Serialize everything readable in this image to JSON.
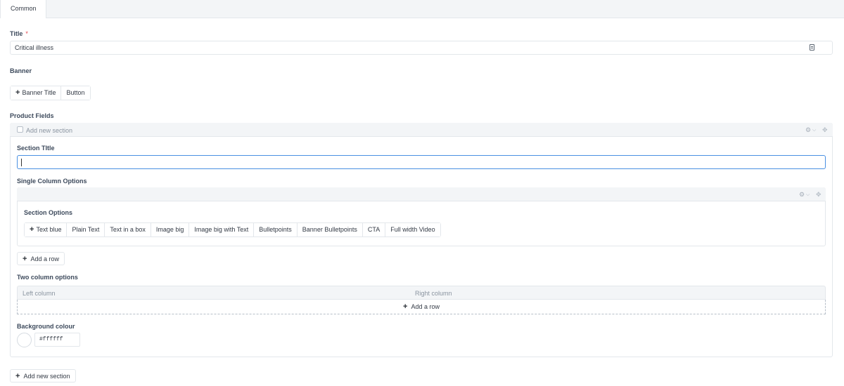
{
  "tabs": [
    {
      "label": "Common"
    }
  ],
  "title_field": {
    "label": "Title",
    "required_mark": "*",
    "value": "Critical illness"
  },
  "banner": {
    "label": "Banner",
    "buttons": [
      {
        "label": "Banner Title"
      },
      {
        "label": "Button"
      }
    ]
  },
  "product_fields": {
    "label": "Product Fields",
    "section_header": "Add new section",
    "section_title_label": "Section TItle",
    "section_title_value": "",
    "single_column": {
      "label": "Single Column Options",
      "section_options_label": "Section Options",
      "options": [
        {
          "label": "Text blue"
        },
        {
          "label": "Plain Text"
        },
        {
          "label": "Text in a box"
        },
        {
          "label": "Image big"
        },
        {
          "label": "Image big with Text"
        },
        {
          "label": "Bulletpoints"
        },
        {
          "label": "Banner Bulletpoints"
        },
        {
          "label": "CTA"
        },
        {
          "label": "Full width Video"
        }
      ],
      "add_row_label": "Add a row"
    },
    "two_column": {
      "label": "Two column options",
      "left_column": "Left column",
      "right_column": "Right column",
      "add_row_label": "Add a row"
    },
    "background": {
      "label": "Background colour",
      "value": "#ffffff",
      "swatch_color": "#ffffff"
    }
  },
  "add_new_section_label": "Add new section",
  "icons": {
    "plus": "plus-icon",
    "settings": "gear-icon",
    "collapse": "chevron-down-icon",
    "drag": "move-icon",
    "text_mode": "document-icon"
  },
  "colors": {
    "accent_focus": "#4a90e2",
    "required": "#e5484d",
    "panel_header": "#f3f5f7",
    "border": "#e3e7eb"
  }
}
